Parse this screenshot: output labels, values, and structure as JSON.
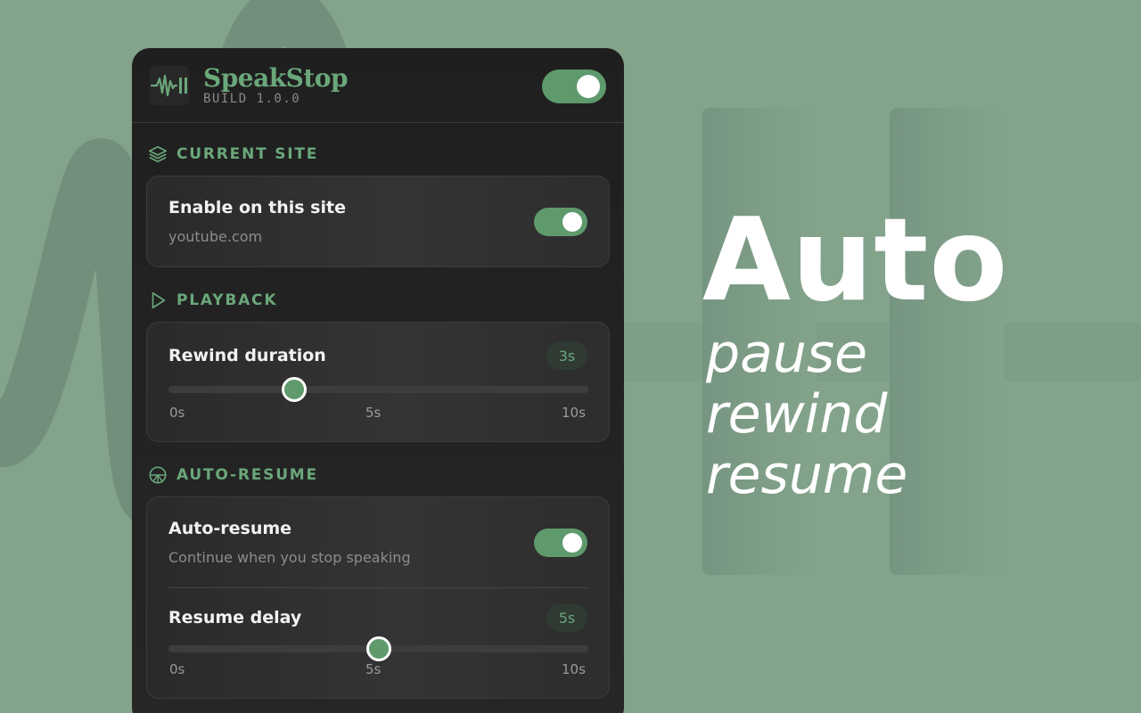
{
  "app": {
    "name": "SpeakStop",
    "build": "BUILD 1.0.0",
    "enabled": true
  },
  "sections": {
    "current_site": {
      "label": "CURRENT SITE",
      "enable_title": "Enable on this site",
      "site": "youtube.com",
      "enabled": true
    },
    "playback": {
      "label": "PLAYBACK",
      "rewind_title": "Rewind duration",
      "rewind_value": "3s",
      "rewind_fraction": 0.3,
      "ticks": [
        "0s",
        "5s",
        "10s"
      ]
    },
    "auto_resume": {
      "label": "AUTO-RESUME",
      "toggle_title": "Auto-resume",
      "toggle_sub": "Continue when you stop speaking",
      "enabled": true,
      "delay_title": "Resume delay",
      "delay_value": "5s",
      "delay_fraction": 0.5,
      "ticks": [
        "0s",
        "5s",
        "10s"
      ]
    }
  },
  "hero": {
    "title": "Auto",
    "lines": [
      "pause",
      "rewind",
      "resume"
    ]
  },
  "colors": {
    "background": "#83a38b",
    "accent": "#6aa77a",
    "toggle_on": "#5e9a6c",
    "panel": "#1f1f1f"
  }
}
